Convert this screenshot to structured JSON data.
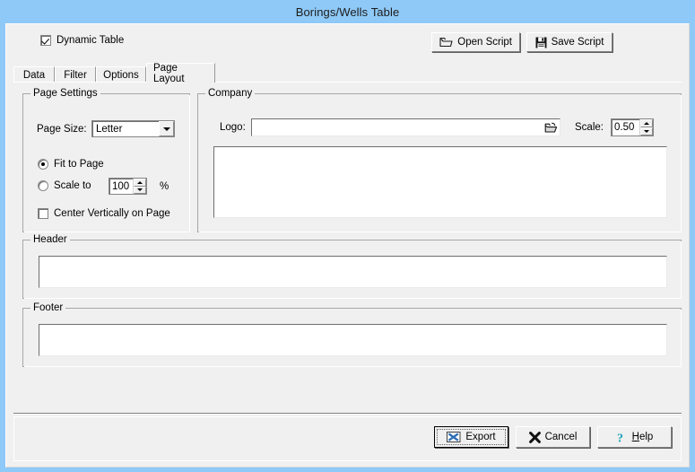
{
  "window": {
    "title": "Borings/Wells Table",
    "titlebar_color": "#8fc9f7",
    "face_color": "#f0f0f0"
  },
  "toolbar": {
    "dynamic_table_label": "Dynamic Table",
    "dynamic_table_checked": true,
    "open_script_label": "Open Script",
    "save_script_label": "Save Script"
  },
  "tabs": [
    {
      "label": "Data",
      "active": false
    },
    {
      "label": "Filter",
      "active": false
    },
    {
      "label": "Options",
      "active": false
    },
    {
      "label": "Page Layout",
      "active": true
    }
  ],
  "page_settings": {
    "group_label": "Page Settings",
    "page_size_label": "Page Size:",
    "page_size_value": "Letter",
    "page_size_options": [
      "Letter"
    ],
    "fit_to_page_label": "Fit to Page",
    "fit_to_page_selected": true,
    "scale_to_label": "Scale to",
    "scale_to_selected": false,
    "scale_to_value": "100",
    "percent_label": "%",
    "center_vertically_label": "Center Vertically on Page",
    "center_vertically_checked": false
  },
  "company": {
    "group_label": "Company",
    "logo_label": "Logo:",
    "logo_value": "",
    "logo_placeholder": "",
    "scale_label": "Scale:",
    "scale_value": "0.50",
    "preview_value": ""
  },
  "header": {
    "group_label": "Header",
    "value": ""
  },
  "footer": {
    "group_label": "Footer",
    "value": ""
  },
  "footer_bar": {
    "export_label": "Export",
    "cancel_label": "Cancel",
    "help_label": "Help",
    "help_mnemonic": "H",
    "export_focused": true
  },
  "icons": {
    "open_folder": "open-folder-icon",
    "floppy_disk": "floppy-disk-icon",
    "browse_folder": "browse-folder-icon",
    "excel_x": "excel-export-icon",
    "cancel_x": "cancel-x-icon",
    "question_mark": "question-mark-icon"
  },
  "colors": {
    "title_bar": "#8fc9f7",
    "excel_blue": "#2f6fb5",
    "help_teal": "#17a2b8"
  }
}
